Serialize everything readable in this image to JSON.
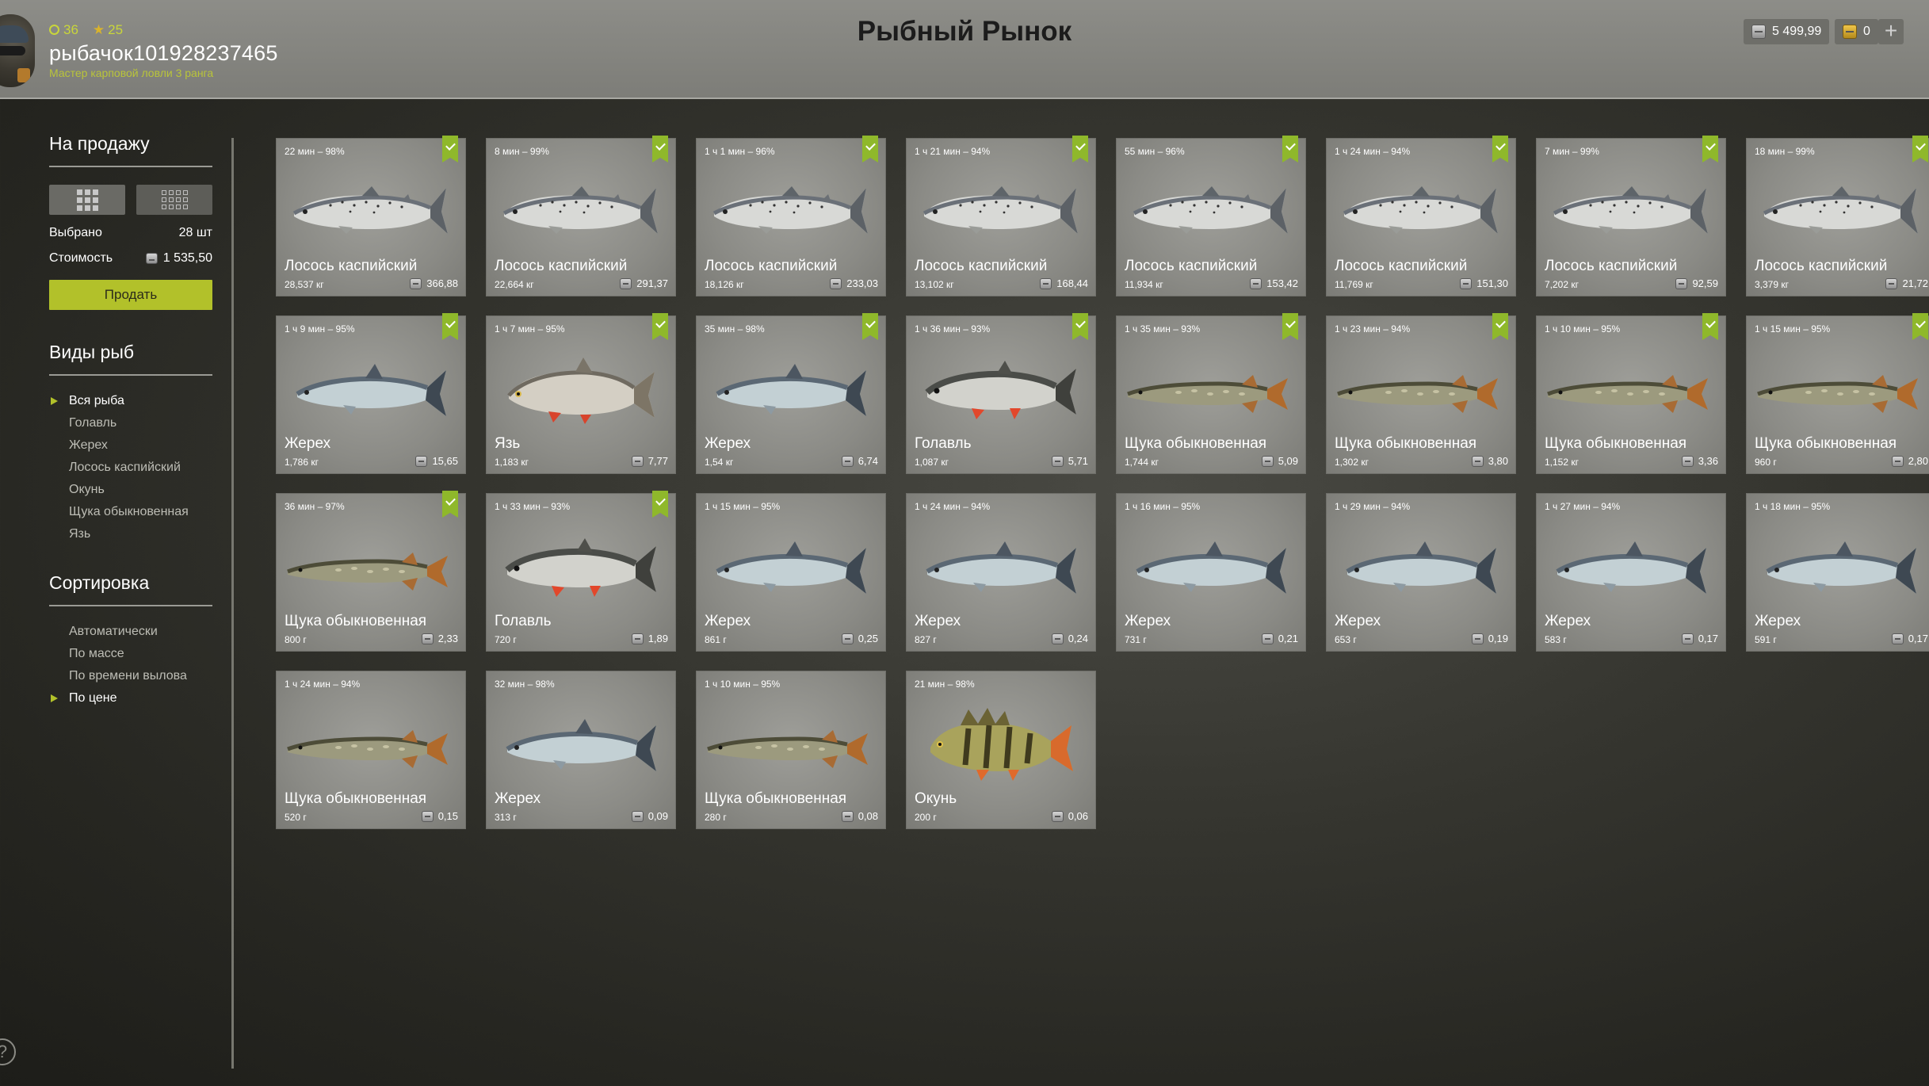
{
  "header": {
    "title": "Рыбный Рынок",
    "level": "36",
    "stars": "25",
    "username": "рыбачок101928237465",
    "rank": "Мастер карповой ловли 3 ранга",
    "silver": "5 499,99",
    "gold": "0",
    "plus_label": "+"
  },
  "sidebar": {
    "for_sale_title": "На продажу",
    "selected_label": "Выбрано",
    "selected_value": "28 шт",
    "cost_label": "Стоимость",
    "cost_value": "1 535,50",
    "sell_label": "Продать",
    "species_title": "Виды рыб",
    "species": [
      "Вся рыба",
      "Голавль",
      "Жерех",
      "Лосось каспийский",
      "Окунь",
      "Щука обыкновенная",
      "Язь"
    ],
    "species_active": 0,
    "sort_title": "Сортировка",
    "sort_options": [
      "Автоматически",
      "По массе",
      "По времени вылова",
      "По цене"
    ],
    "sort_active": 3,
    "help_label": "?"
  },
  "cards": [
    {
      "time": "22 мин – 98%",
      "name": "Лосось каспийский",
      "weight": "28,537 кг",
      "price": "366,88",
      "checked": true,
      "fish": "salmon"
    },
    {
      "time": "8 мин – 99%",
      "name": "Лосось каспийский",
      "weight": "22,664 кг",
      "price": "291,37",
      "checked": true,
      "fish": "salmon"
    },
    {
      "time": "1 ч 1 мин – 96%",
      "name": "Лосось каспийский",
      "weight": "18,126 кг",
      "price": "233,03",
      "checked": true,
      "fish": "salmon"
    },
    {
      "time": "1 ч 21 мин – 94%",
      "name": "Лосось каспийский",
      "weight": "13,102 кг",
      "price": "168,44",
      "checked": true,
      "fish": "salmon"
    },
    {
      "time": "55 мин – 96%",
      "name": "Лосось каспийский",
      "weight": "11,934 кг",
      "price": "153,42",
      "checked": true,
      "fish": "salmon"
    },
    {
      "time": "1 ч 24 мин – 94%",
      "name": "Лосось каспийский",
      "weight": "11,769 кг",
      "price": "151,30",
      "checked": true,
      "fish": "salmon"
    },
    {
      "time": "7 мин – 99%",
      "name": "Лосось каспийский",
      "weight": "7,202 кг",
      "price": "92,59",
      "checked": true,
      "fish": "salmon"
    },
    {
      "time": "18 мин – 99%",
      "name": "Лосось каспийский",
      "weight": "3,379 кг",
      "price": "21,72",
      "checked": true,
      "fish": "salmon"
    },
    {
      "time": "1 ч 9 мин – 95%",
      "name": "Жерех",
      "weight": "1,786 кг",
      "price": "15,65",
      "checked": true,
      "fish": "asp"
    },
    {
      "time": "1 ч 7 мин – 95%",
      "name": "Язь",
      "weight": "1,183 кг",
      "price": "7,77",
      "checked": true,
      "fish": "ide"
    },
    {
      "time": "35 мин – 98%",
      "name": "Жерех",
      "weight": "1,54 кг",
      "price": "6,74",
      "checked": true,
      "fish": "asp"
    },
    {
      "time": "1 ч 36 мин – 93%",
      "name": "Голавль",
      "weight": "1,087 кг",
      "price": "5,71",
      "checked": true,
      "fish": "chub"
    },
    {
      "time": "1 ч 35 мин – 93%",
      "name": "Щука обыкновенная",
      "weight": "1,744 кг",
      "price": "5,09",
      "checked": true,
      "fish": "pike"
    },
    {
      "time": "1 ч 23 мин – 94%",
      "name": "Щука обыкновенная",
      "weight": "1,302 кг",
      "price": "3,80",
      "checked": true,
      "fish": "pike"
    },
    {
      "time": "1 ч 10 мин – 95%",
      "name": "Щука обыкновенная",
      "weight": "1,152 кг",
      "price": "3,36",
      "checked": true,
      "fish": "pike"
    },
    {
      "time": "1 ч 15 мин – 95%",
      "name": "Щука обыкновенная",
      "weight": "960 г",
      "price": "2,80",
      "checked": true,
      "fish": "pike"
    },
    {
      "time": "36 мин – 97%",
      "name": "Щука обыкновенная",
      "weight": "800 г",
      "price": "2,33",
      "checked": true,
      "fish": "pike"
    },
    {
      "time": "1 ч 33 мин – 93%",
      "name": "Голавль",
      "weight": "720 г",
      "price": "1,89",
      "checked": true,
      "fish": "chub"
    },
    {
      "time": "1 ч 15 мин – 95%",
      "name": "Жерех",
      "weight": "861 г",
      "price": "0,25",
      "checked": false,
      "fish": "asp"
    },
    {
      "time": "1 ч 24 мин – 94%",
      "name": "Жерех",
      "weight": "827 г",
      "price": "0,24",
      "checked": false,
      "fish": "asp"
    },
    {
      "time": "1 ч 16 мин – 95%",
      "name": "Жерех",
      "weight": "731 г",
      "price": "0,21",
      "checked": false,
      "fish": "asp"
    },
    {
      "time": "1 ч 29 мин – 94%",
      "name": "Жерех",
      "weight": "653 г",
      "price": "0,19",
      "checked": false,
      "fish": "asp"
    },
    {
      "time": "1 ч 27 мин – 94%",
      "name": "Жерех",
      "weight": "583 г",
      "price": "0,17",
      "checked": false,
      "fish": "asp"
    },
    {
      "time": "1 ч 18 мин – 95%",
      "name": "Жерех",
      "weight": "591 г",
      "price": "0,17",
      "checked": false,
      "fish": "asp"
    },
    {
      "time": "1 ч 24 мин – 94%",
      "name": "Щука обыкновенная",
      "weight": "520 г",
      "price": "0,15",
      "checked": false,
      "fish": "pike"
    },
    {
      "time": "32 мин – 98%",
      "name": "Жерех",
      "weight": "313 г",
      "price": "0,09",
      "checked": false,
      "fish": "asp"
    },
    {
      "time": "1 ч 10 мин – 95%",
      "name": "Щука обыкновенная",
      "weight": "280 г",
      "price": "0,08",
      "checked": false,
      "fish": "pike"
    },
    {
      "time": "21 мин – 98%",
      "name": "Окунь",
      "weight": "200 г",
      "price": "0,06",
      "checked": false,
      "fish": "perch"
    }
  ]
}
